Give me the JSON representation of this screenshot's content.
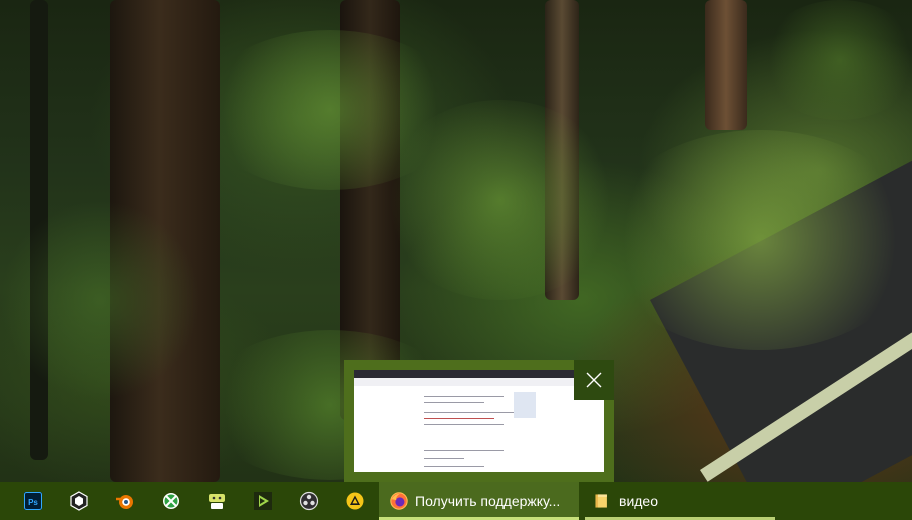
{
  "desktop": {
    "wallpaper": "forest-road-photo"
  },
  "preview": {
    "window_title": "Получить поддержку",
    "close_icon": "close-icon"
  },
  "taskbar": {
    "pinned": [
      {
        "name": "photoshop-icon",
        "app": "Photoshop",
        "color": "#31a8ff"
      },
      {
        "name": "unity-icon",
        "app": "Unity",
        "color": "#ffffff"
      },
      {
        "name": "blender-icon",
        "app": "Blender",
        "color": "#ea7600"
      },
      {
        "name": "xbox-app-icon",
        "app": "Xbox",
        "color": "#2ea043"
      },
      {
        "name": "keyboard-app-icon",
        "app": "Keyboard tool",
        "color": "#d7e36a"
      },
      {
        "name": "media-player-icon",
        "app": "Media player",
        "color": "#9fd34a"
      },
      {
        "name": "obs-icon",
        "app": "OBS",
        "color": "#e0e0e0"
      },
      {
        "name": "warning-app-icon",
        "app": "App",
        "color": "#f5c518"
      }
    ],
    "tasks": [
      {
        "name": "task-firefox",
        "label": "Получить поддержку...",
        "icon": "firefox-icon",
        "active": true
      },
      {
        "name": "task-folder",
        "label": "видео",
        "icon": "folder-icon",
        "active": false
      }
    ],
    "colors": {
      "bar": "#2b4708",
      "active_task": "#4b6a1e",
      "indicator": "#c7e07a"
    }
  }
}
